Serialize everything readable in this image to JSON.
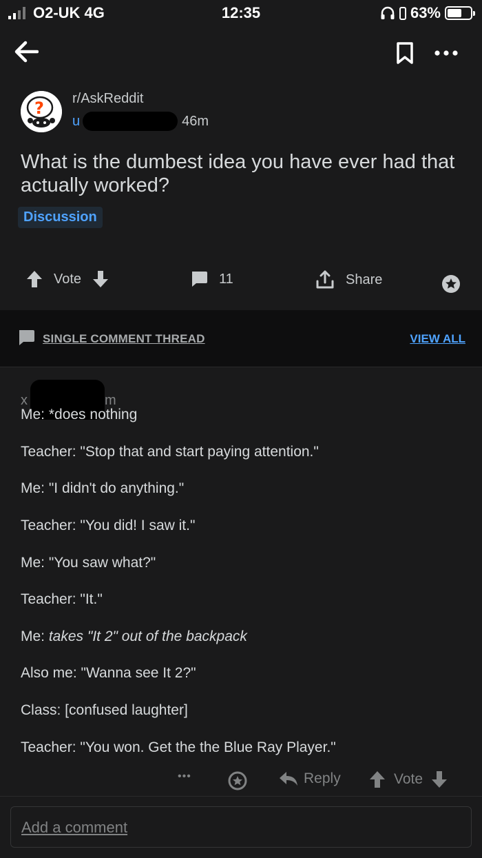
{
  "status_bar": {
    "carrier": "O2-UK 4G",
    "time": "12:35",
    "battery": "63%",
    "battery_level": 0.63
  },
  "post": {
    "subreddit": "r/AskReddit",
    "user_prefix": "u",
    "age": "46m",
    "title": "What is the dumbest idea you have ever had that actually worked?",
    "flair": "Discussion",
    "vote_label": "Vote",
    "comment_count": "11",
    "share_label": "Share"
  },
  "thread": {
    "label": "SINGLE COMMENT THREAD",
    "view_all": "VIEW ALL"
  },
  "comment": {
    "author_prefix": "x",
    "age_suffix": "m",
    "lines": [
      {
        "prefix": "Me: ",
        "text": "*does nothing"
      },
      {
        "prefix": "",
        "text": "Teacher: \"Stop that and start paying attention.\""
      },
      {
        "prefix": "",
        "text": "Me: \"I didn't do anything.\""
      },
      {
        "prefix": "",
        "text": "Teacher: \"You did! I saw it.\""
      },
      {
        "prefix": "",
        "text": "Me: \"You saw what?\""
      },
      {
        "prefix": "",
        "text": "Teacher: \"It.\""
      },
      {
        "prefix": "Me: ",
        "text": "takes \"It 2\" out of the backpack"
      },
      {
        "prefix": "",
        "text": "Also me: \"Wanna see It 2?\""
      },
      {
        "prefix": "",
        "text": "Class: [confused laughter]"
      },
      {
        "prefix": "",
        "text": "Teacher: \"You won. Get the the Blue Ray Player.\""
      }
    ],
    "more": "•••",
    "reply_label": "Reply",
    "vote_label": "Vote"
  },
  "composer": {
    "placeholder": "Add a comment"
  },
  "colors": {
    "background": "#1a1a1b",
    "thread_bar": "#0e0e0f",
    "link_blue": "#4fa3ff"
  }
}
